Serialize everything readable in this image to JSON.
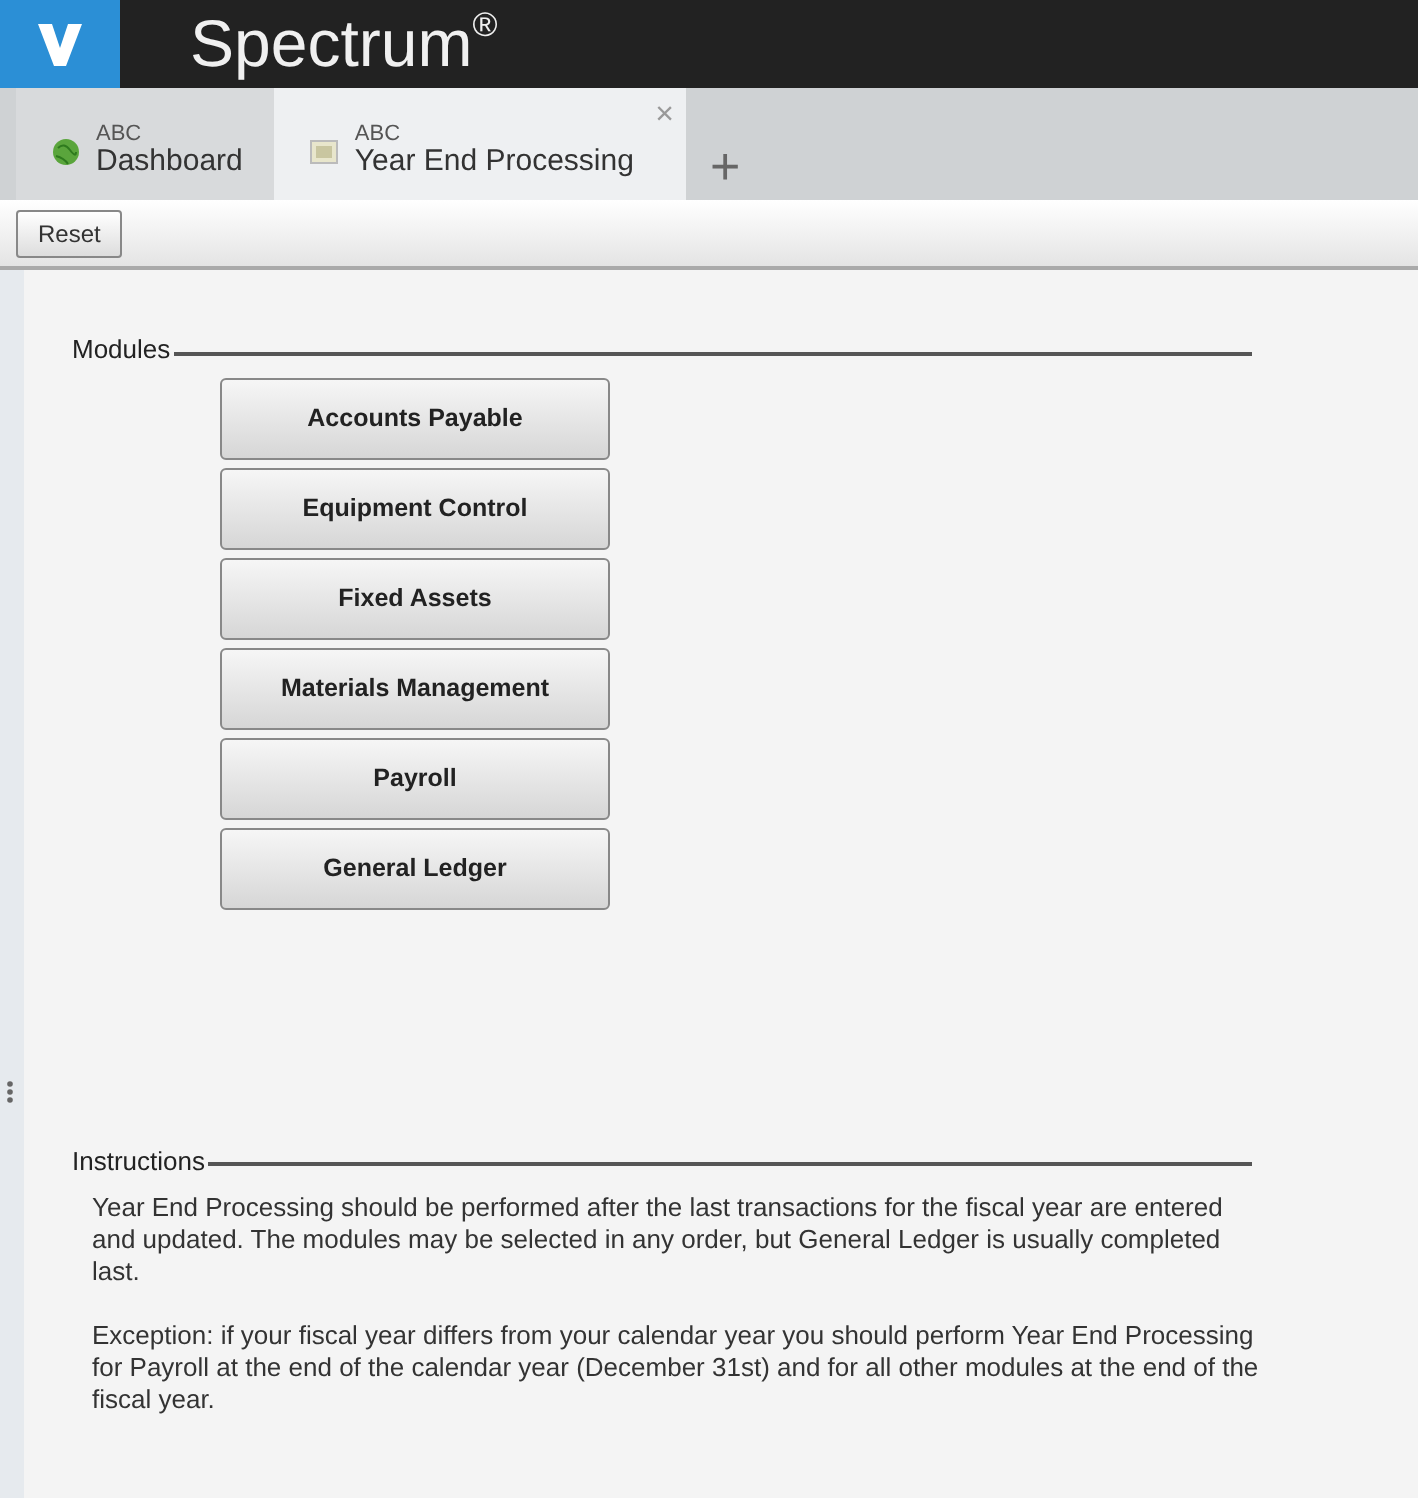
{
  "app": {
    "title": "Spectrum$^{®}$"
  },
  "tabs": [
    {
      "company": "ABC",
      "label": "Dashboard",
      "kind": "dashboard",
      "selected": false
    },
    {
      "company": "ABC",
      "label": "Year End Processing",
      "kind": "document",
      "selected": true,
      "close": "×"
    }
  ],
  "new_tab": "+",
  "toolbar": {
    "buttons": [
      "Reset"
    ]
  },
  "modules": {
    "heading": "Modules",
    "buttons": [
      "Accounts Payable",
      "Equipment Control",
      "Fixed Assets",
      "Materials Management",
      "Payroll",
      "General Ledger"
    ]
  },
  "instructions": {
    "heading": "Instructions",
    "paragraphs": [
      "Year End Processing should be performed after the last transactions for the fiscal year are entered and updated. The modules may be selected in any order, but General Ledger is usually completed last.",
      "Exception: if your fiscal year differs from your calendar year you should perform Year End Processing for Payroll at the end of the calendar year (December 31st) and for all other modules at the end of the fiscal year."
    ]
  }
}
